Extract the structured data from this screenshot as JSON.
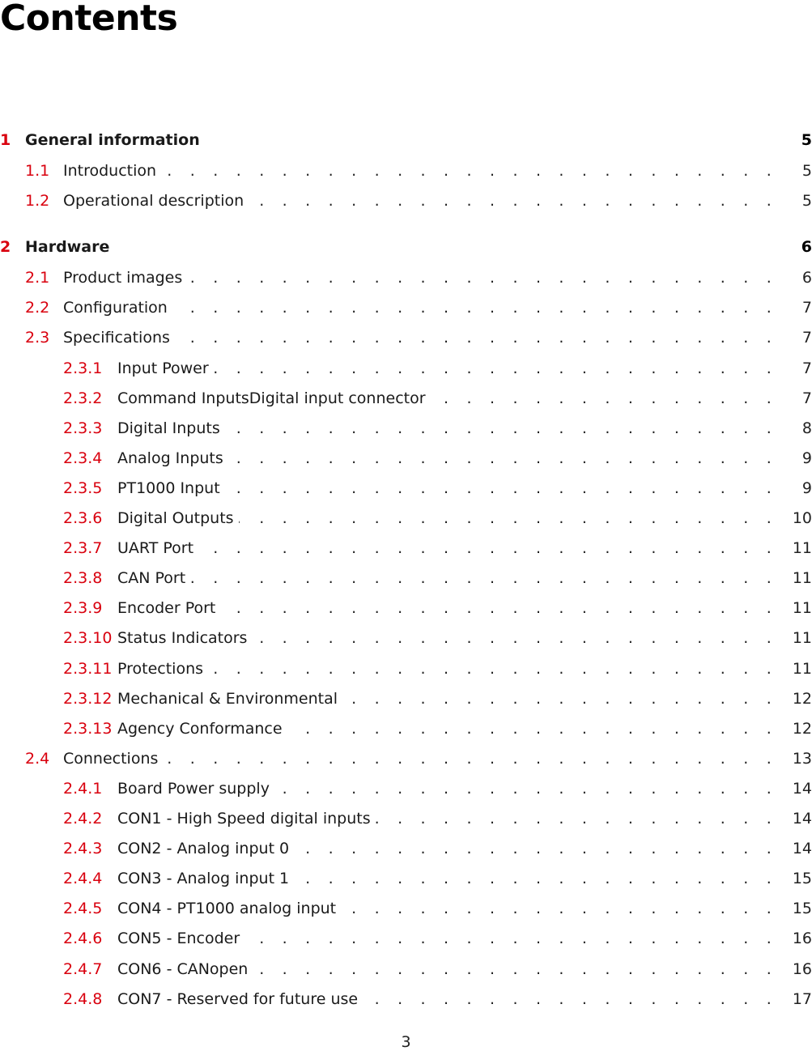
{
  "page": {
    "title": "Contents",
    "page_number": "3"
  },
  "accent_color": "#d9000e",
  "toc": [
    {
      "level": "chapter",
      "number": "1",
      "label": "General information",
      "page": "5"
    },
    {
      "level": "section",
      "number": "1.1",
      "label": "Introduction",
      "page": "5"
    },
    {
      "level": "section",
      "number": "1.2",
      "label": "Operational description",
      "page": "5"
    },
    {
      "level": "chapter",
      "number": "2",
      "label": "Hardware",
      "page": "6"
    },
    {
      "level": "section",
      "number": "2.1",
      "label": "Product images",
      "page": "6"
    },
    {
      "level": "section",
      "number": "2.2",
      "label": "Configuration",
      "page": "7"
    },
    {
      "level": "section",
      "number": "2.3",
      "label": "Specifications",
      "page": "7"
    },
    {
      "level": "subsection",
      "number": "2.3.1",
      "label": "Input Power",
      "page": "7"
    },
    {
      "level": "subsection",
      "number": "2.3.2",
      "label": "Command InputsDigital input connector",
      "page": "7"
    },
    {
      "level": "subsection",
      "number": "2.3.3",
      "label": "Digital Inputs",
      "page": "8"
    },
    {
      "level": "subsection",
      "number": "2.3.4",
      "label": "Analog Inputs",
      "page": "9"
    },
    {
      "level": "subsection",
      "number": "2.3.5",
      "label": "PT1000 Input",
      "page": "9"
    },
    {
      "level": "subsection",
      "number": "2.3.6",
      "label": "Digital Outputs",
      "page": "10"
    },
    {
      "level": "subsection",
      "number": "2.3.7",
      "label": "UART Port",
      "page": "11"
    },
    {
      "level": "subsection",
      "number": "2.3.8",
      "label": "CAN Port",
      "page": "11"
    },
    {
      "level": "subsection",
      "number": "2.3.9",
      "label": "Encoder Port",
      "page": "11"
    },
    {
      "level": "subsection",
      "number": "2.3.10",
      "label": "Status Indicators",
      "page": "11"
    },
    {
      "level": "subsection",
      "number": "2.3.11",
      "label": "Protections",
      "page": "11"
    },
    {
      "level": "subsection",
      "number": "2.3.12",
      "label": "Mechanical & Environmental",
      "page": "12"
    },
    {
      "level": "subsection",
      "number": "2.3.13",
      "label": "Agency Conformance",
      "page": "12"
    },
    {
      "level": "section",
      "number": "2.4",
      "label": "Connections",
      "page": "13"
    },
    {
      "level": "subsection",
      "number": "2.4.1",
      "label": "Board Power supply",
      "page": "14"
    },
    {
      "level": "subsection",
      "number": "2.4.2",
      "label": "CON1 - High Speed digital inputs",
      "page": "14"
    },
    {
      "level": "subsection",
      "number": "2.4.3",
      "label": "CON2 - Analog input 0",
      "page": "14"
    },
    {
      "level": "subsection",
      "number": "2.4.4",
      "label": "CON3 - Analog input 1",
      "page": "15"
    },
    {
      "level": "subsection",
      "number": "2.4.5",
      "label": "CON4 - PT1000 analog input",
      "page": "15"
    },
    {
      "level": "subsection",
      "number": "2.4.6",
      "label": "CON5 - Encoder",
      "page": "16"
    },
    {
      "level": "subsection",
      "number": "2.4.7",
      "label": "CON6 - CANopen",
      "page": "16"
    },
    {
      "level": "subsection",
      "number": "2.4.8",
      "label": "CON7 - Reserved for future use",
      "page": "17"
    }
  ]
}
